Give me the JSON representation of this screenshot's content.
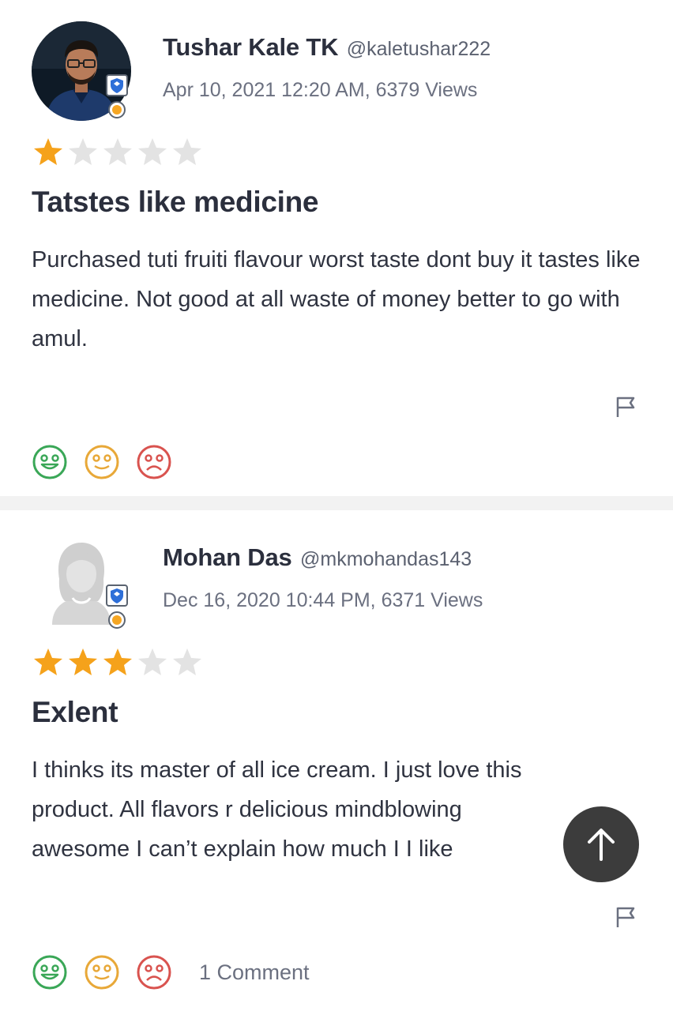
{
  "reviews": [
    {
      "author": "Tushar Kale TK",
      "handle": "@kaletushar222",
      "meta": "Apr 10, 2021 12:20 AM, 6379 Views",
      "rating": 1,
      "max_rating": 5,
      "title": "Tatstes like medicine",
      "body": "Purchased tuti fruiti flavour worst taste dont buy it tastes like medicine. Not good at all waste of money better to go with amul.",
      "comments": ""
    },
    {
      "author": "Mohan Das",
      "handle": "@mkmohandas143",
      "meta": "Dec 16, 2020 10:44 PM, 6371 Views",
      "rating": 3,
      "max_rating": 5,
      "title": "Exlent",
      "body": "I thinks its master of all ice cream. I just love this product. All flavors r delicious mindblowing awesome I can’t explain how much I I like",
      "comments": "1 Comment"
    }
  ],
  "colors": {
    "star_filled": "#f5a21b",
    "star_empty": "#e3e3e3",
    "happy": "#3aa757",
    "neutral": "#e8a838",
    "sad": "#d9534f",
    "scroll_button": "#3c3c3c"
  },
  "icons": {
    "badge": "shield-icon",
    "flag": "flag-icon",
    "scroll": "arrow-up-icon"
  }
}
